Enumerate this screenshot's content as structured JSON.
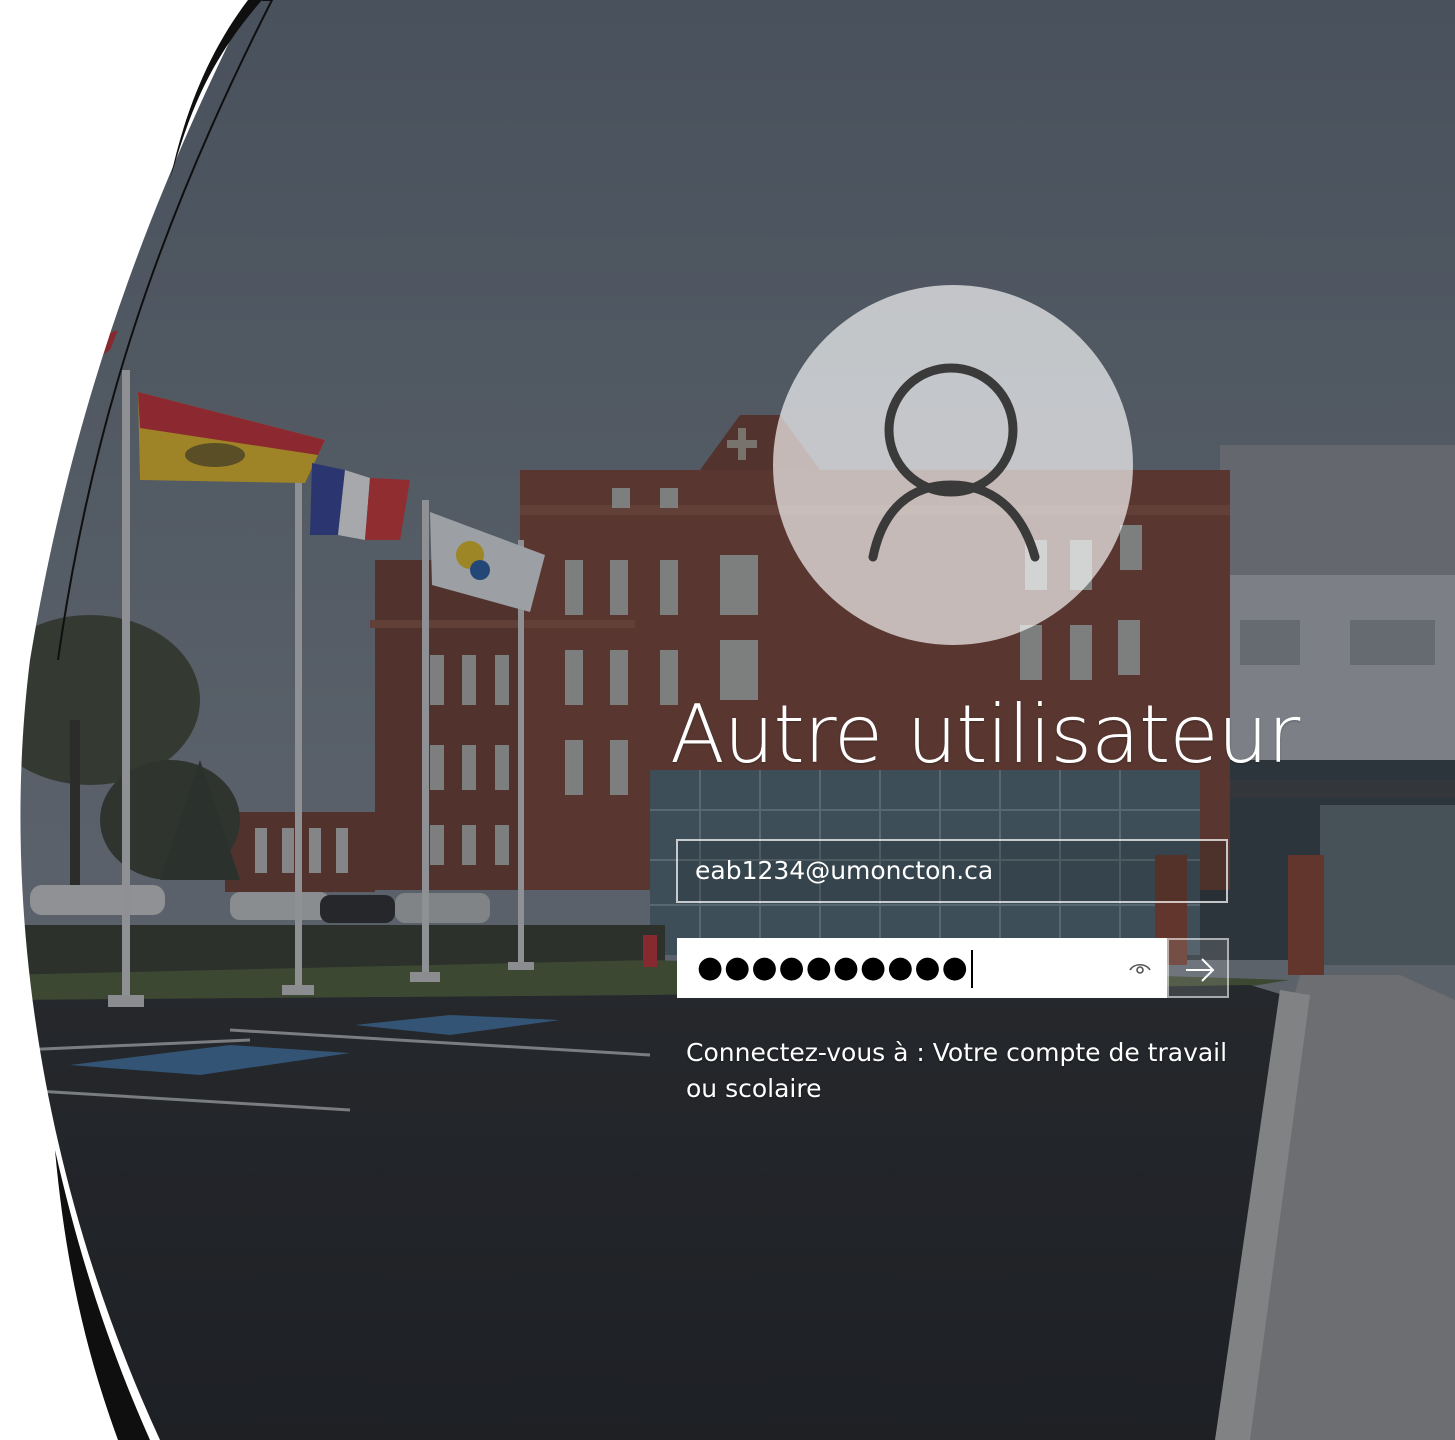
{
  "user": {
    "display_name": "Autre utilisateur",
    "avatar_icon": "person-icon"
  },
  "login": {
    "username_value": "eab1234@umoncton.ca",
    "password_mask": "●●●●●●●●●●",
    "reveal_icon": "eye-icon",
    "submit_icon": "arrow-right-icon",
    "sign_in_to": "Connectez-vous à : Votre compte de travail ou scolaire"
  },
  "colors": {
    "text": "#ffffff",
    "sky": "#6e7884",
    "brick": "#7a3d2c",
    "decor_stroke": "#0f0f0f"
  }
}
